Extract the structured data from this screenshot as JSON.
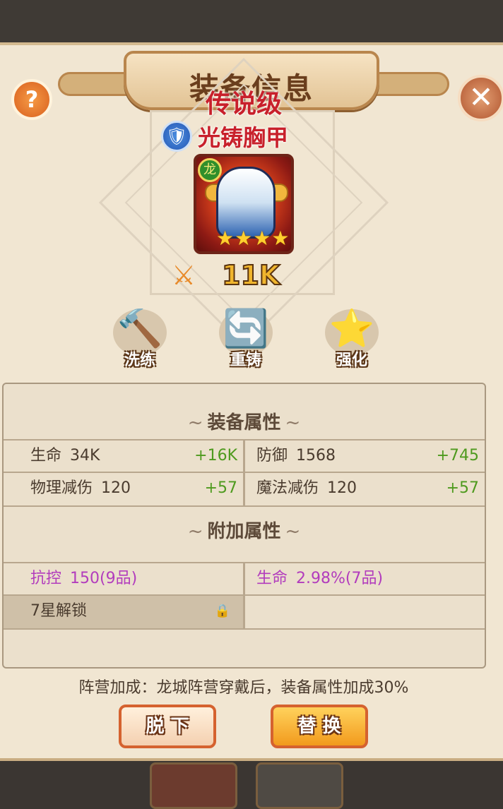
{
  "dialog": {
    "title": "装备信息",
    "help_label": "?",
    "close_label": "✕"
  },
  "item": {
    "rarity": "传说级",
    "name": "光铸胸甲",
    "type_icon": "shield-icon",
    "faction_icon": "dragon-faction-icon",
    "stars": [
      "★",
      "★",
      "★",
      "★"
    ],
    "power_icon": "crossed-swords-icon",
    "power": "11K",
    "rarity_color": "#c8202b"
  },
  "actions": [
    {
      "label": "洗练",
      "icon": "hammer-icon",
      "glyph": "🔨"
    },
    {
      "label": "重铸",
      "icon": "recycle-icon",
      "glyph": "🔄"
    },
    {
      "label": "强化",
      "icon": "star-icon",
      "glyph": "⭐"
    }
  ],
  "equipment_attributes": {
    "title": "装备属性",
    "curl_left": "~",
    "curl_right": "~",
    "rows": [
      [
        {
          "name": "生命",
          "value": "34K",
          "bonus": "+16K"
        },
        {
          "name": "防御",
          "value": "1568",
          "bonus": "+745"
        }
      ],
      [
        {
          "name": "物理减伤",
          "value": "120",
          "bonus": "+57"
        },
        {
          "name": "魔法减伤",
          "value": "120",
          "bonus": "+57"
        }
      ]
    ]
  },
  "extra_attributes": {
    "title": "附加属性",
    "attrs": [
      {
        "name": "抗控",
        "value": "150(9品)"
      },
      {
        "name": "生命",
        "value": "2.98%(7品)"
      }
    ],
    "locked_slot": "7星解锁",
    "lock_icon": "🔒"
  },
  "faction_note": "阵营加成：龙城阵营穿戴后，装备属性加成30%",
  "buttons": {
    "unequip": "脱 下",
    "replace": "替 换"
  },
  "colors": {
    "bonus_green": "#4e9a1e",
    "extra_purple": "#b23cbd",
    "panel_bg": "#f1e6d2"
  }
}
